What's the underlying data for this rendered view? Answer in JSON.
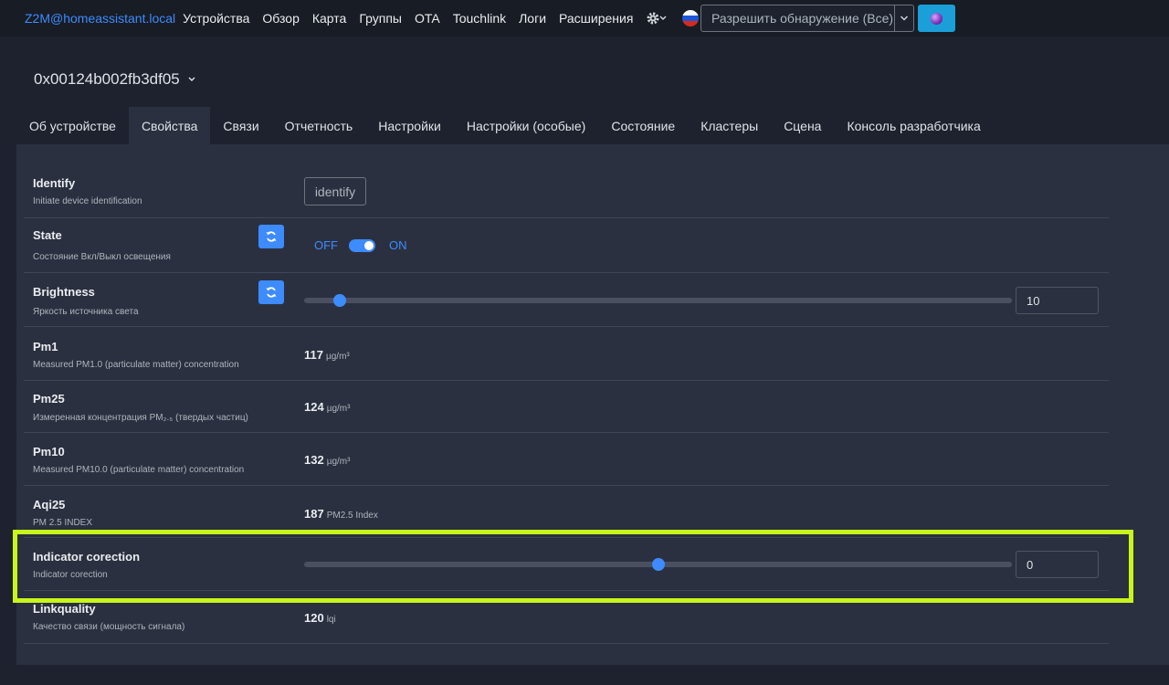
{
  "nav": {
    "brand": "Z2M@homeassistant.local",
    "links": [
      "Устройства",
      "Обзор",
      "Карта",
      "Группы",
      "OTA",
      "Touchlink",
      "Логи",
      "Расширения"
    ],
    "discover": "Разрешить обнаружение (Все)"
  },
  "device": {
    "title": "0x00124b002fb3df05"
  },
  "tabs": [
    "Об устройстве",
    "Свойства",
    "Связи",
    "Отчетность",
    "Настройки",
    "Настройки (особые)",
    "Состояние",
    "Кластеры",
    "Сцена",
    "Консоль разработчика"
  ],
  "rows": {
    "identify": {
      "name": "Identify",
      "desc": "Initiate device identification",
      "button": "identify"
    },
    "state": {
      "name": "State",
      "desc": "Состояние Вкл/Выкл освещения",
      "off": "OFF",
      "on": "ON"
    },
    "brightness": {
      "name": "Brightness",
      "desc": "Яркость источника света",
      "value": "10",
      "level": 0.05
    },
    "pm1": {
      "name": "Pm1",
      "desc": "Measured PM1.0 (particulate matter) concentration",
      "value": "117",
      "unit": "µg/m³"
    },
    "pm25": {
      "name": "Pm25",
      "desc": "Измеренная концентрация PM₂.₅ (твердых частиц)",
      "value": "124",
      "unit": "µg/m³"
    },
    "pm10": {
      "name": "Pm10",
      "desc": "Measured PM10.0 (particulate matter) concentration",
      "value": "132",
      "unit": "µg/m³"
    },
    "aqi25": {
      "name": "Aqi25",
      "desc": "PM 2.5 INDEX",
      "value": "187",
      "unit": "PM2.5 Index"
    },
    "indicator": {
      "name": "Indicator corection",
      "desc": "Indicator corection",
      "value": "0",
      "level": 0.5
    },
    "linkquality": {
      "name": "Linkquality",
      "desc": "Качество связи (мощность сигнала)",
      "value": "120",
      "unit": "lqi"
    }
  },
  "colors": {
    "accent": "#3d8bfd",
    "highlight": "#c8f51c"
  }
}
